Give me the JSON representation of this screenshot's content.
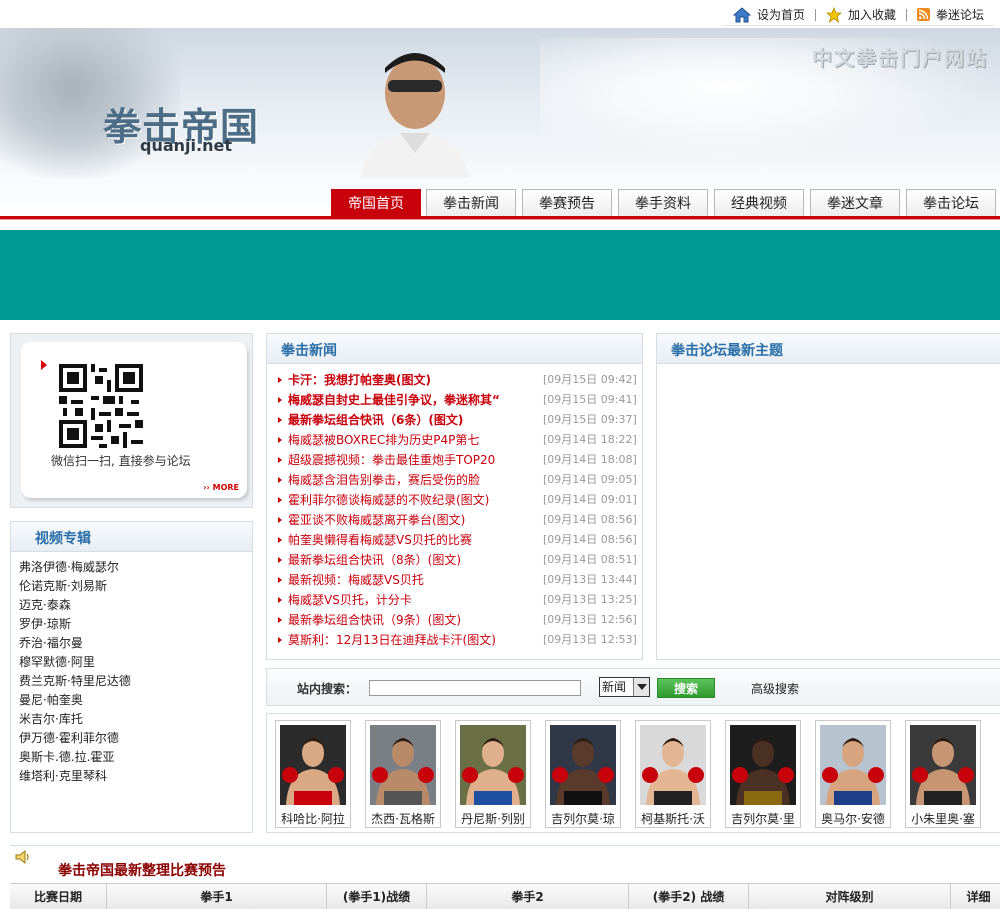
{
  "toplinks": [
    {
      "label": "设为首页",
      "icon": "home-icon"
    },
    {
      "label": "加入收藏",
      "icon": "star-icon"
    },
    {
      "label": "拳迷论坛",
      "icon": "rss-icon"
    }
  ],
  "header": {
    "logo_cn": "拳击帝国",
    "logo_en": "quanji.net",
    "slogan": "中文拳击门户网站"
  },
  "nav": {
    "tabs": [
      "帝国首页",
      "拳击新闻",
      "拳赛预告",
      "拳手资料",
      "经典视频",
      "拳迷文章",
      "拳击论坛"
    ],
    "active": 0
  },
  "qr": {
    "caption": "微信扫一扫, 直接参与论坛",
    "more": "›› MORE"
  },
  "video": {
    "title": "视频专辑",
    "items": [
      "弗洛伊德·梅威瑟尔",
      "伦诺克斯·刘易斯",
      "迈克·泰森",
      "罗伊·琼斯",
      "乔治·福尔曼",
      "穆罕默德·阿里",
      "费兰克斯·特里尼达德",
      "曼尼·帕奎奥",
      "米吉尔·库托",
      "伊万德·霍利菲尔德",
      "奥斯卡.德.拉.霍亚",
      "维塔利·克里琴科"
    ]
  },
  "news": {
    "title": "拳击新闻",
    "items": [
      {
        "title": "卡汗：我想打帕奎奥(图文)",
        "date": "[09月15日 09:42]",
        "bold": true
      },
      {
        "title": "梅威瑟自封史上最佳引争议，拳迷称其“",
        "date": "[09月15日 09:41]",
        "bold": true
      },
      {
        "title": "最新拳坛组合快讯（6条）(图文)",
        "date": "[09月15日 09:37]",
        "bold": true
      },
      {
        "title": "梅威瑟被BOXREC排为历史P4P第七",
        "date": "[09月14日 18:22]",
        "bold": false
      },
      {
        "title": "超级震撼视频：拳击最佳重炮手TOP20",
        "date": "[09月14日 18:08]",
        "bold": false
      },
      {
        "title": "梅威瑟含泪告别拳击，赛后受伤的脸",
        "date": "[09月14日 09:05]",
        "bold": false
      },
      {
        "title": "霍利菲尔德谈梅威瑟的不败纪录(图文)",
        "date": "[09月14日 09:01]",
        "bold": false
      },
      {
        "title": "霍亚谈不败梅威瑟离开拳台(图文)",
        "date": "[09月14日 08:56]",
        "bold": false
      },
      {
        "title": "帕奎奥懒得看梅威瑟VS贝托的比赛",
        "date": "[09月14日 08:56]",
        "bold": false
      },
      {
        "title": "最新拳坛组合快讯（8条）(图文)",
        "date": "[09月14日 08:51]",
        "bold": false
      },
      {
        "title": "最新视频：梅威瑟VS贝托",
        "date": "[09月13日 13:44]",
        "bold": false
      },
      {
        "title": "梅威瑟VS贝托，计分卡",
        "date": "[09月13日 13:25]",
        "bold": false
      },
      {
        "title": "最新拳坛组合快讯（9条）(图文)",
        "date": "[09月13日 12:56]",
        "bold": false
      },
      {
        "title": "莫斯利：12月13日在迪拜战卡汗(图文)",
        "date": "[09月13日 12:53]",
        "bold": false
      }
    ]
  },
  "forum": {
    "title": "拳击论坛最新主题"
  },
  "search": {
    "label": "站内搜索：",
    "value": "",
    "select": "新闻",
    "button": "搜索",
    "advanced": "高级搜索"
  },
  "boxers": [
    {
      "name": "科哈比·阿拉",
      "skin": "#d9a983",
      "trunks": "#c8000c",
      "bg": "#2b2b2b"
    },
    {
      "name": "杰西·瓦格斯",
      "skin": "#b98a68",
      "trunks": "#555555",
      "bg": "#7a7f86"
    },
    {
      "name": "丹尼斯·列别",
      "skin": "#e0b08c",
      "trunks": "#1f4fa0",
      "bg": "#6b6f45"
    },
    {
      "name": "吉列尔莫·琼",
      "skin": "#5a3a2a",
      "trunks": "#111111",
      "bg": "#303848"
    },
    {
      "name": "柯基斯托·沃",
      "skin": "#e3b593",
      "trunks": "#222222",
      "bg": "#d9d9d9"
    },
    {
      "name": "吉列尔莫·里",
      "skin": "#4b3024",
      "trunks": "#8a6a10",
      "bg": "#1d1d1d"
    },
    {
      "name": "奥马尔·安德",
      "skin": "#d7a480",
      "trunks": "#1d3f8a",
      "bg": "#b8c3d0"
    },
    {
      "name": "小朱里奥·塞",
      "skin": "#c89572",
      "trunks": "#222222",
      "bg": "#3a3a3a"
    }
  ],
  "match": {
    "title": "拳击帝国最新整理比赛预告",
    "columns": [
      "比赛日期",
      "拳手1",
      "(拳手1)战绩",
      "拳手2",
      "(拳手2) 战绩",
      "对阵级别",
      "详细"
    ]
  },
  "colors": {
    "brand_red": "#c8000c",
    "teal": "#009a94",
    "panel_title": "#2a6fa8"
  }
}
